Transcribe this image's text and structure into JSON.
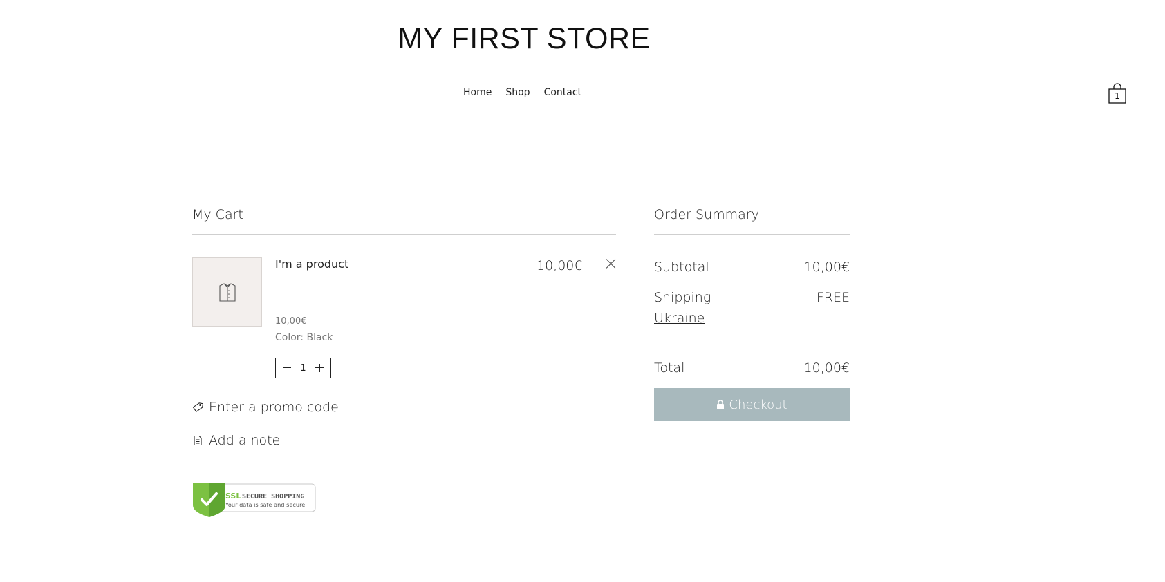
{
  "header": {
    "store_title": "MY FIRST STORE",
    "nav": [
      "Home",
      "Shop",
      "Contact"
    ],
    "cart_count": "1"
  },
  "cart": {
    "title": "My Cart",
    "items": [
      {
        "name": "I'm a product",
        "unit_price": "10,00€",
        "option": "Color: Black",
        "quantity": "1",
        "total": "10,00€",
        "image_icon": "shirt-icon"
      }
    ],
    "promo_label": "Enter a promo code",
    "note_label": "Add a note"
  },
  "ssl_badge": {
    "title": "SSL",
    "subtitle": "SECURE SHOPPING",
    "tagline": "Your data is safe and secure."
  },
  "summary": {
    "title": "Order Summary",
    "subtotal_label": "Subtotal",
    "subtotal_value": "10,00€",
    "shipping_label": "Shipping",
    "shipping_value": "FREE",
    "shipping_destination": "Ukraine",
    "total_label": "Total",
    "total_value": "10,00€",
    "checkout_label": "Checkout"
  },
  "colors": {
    "checkout_button": "#a8b9bd",
    "thumb_background": "#f3efed",
    "ssl_green": "#7cc142"
  }
}
